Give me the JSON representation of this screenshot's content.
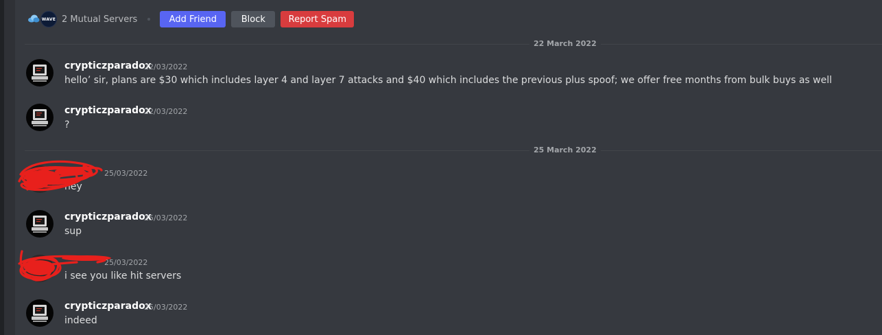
{
  "header": {
    "server_icon_label": "WAVE",
    "mutual_servers": "2 Mutual Servers",
    "add_friend_label": "Add Friend",
    "block_label": "Block",
    "report_spam_label": "Report Spam"
  },
  "dividers": [
    {
      "label": "22 March 2022"
    },
    {
      "label": "25 March 2022"
    }
  ],
  "messages": [
    {
      "author": "crypticzparadox",
      "timestamp": "22/03/2022",
      "content": "hello’  sir, plans are $30  which includes layer 4 and layer 7 attacks and $40 which includes the previous plus spoof; we offer free months from bulk buys as well"
    },
    {
      "author": "crypticzparadox",
      "timestamp": "22/03/2022",
      "content": "?"
    },
    {
      "author": "",
      "timestamp": "25/03/2022",
      "content": "hey"
    },
    {
      "author": "crypticzparadox",
      "timestamp": "25/03/2022",
      "content": "sup"
    },
    {
      "author": "",
      "timestamp": "25/03/2022",
      "content": "i see you like hit servers"
    },
    {
      "author": "crypticzparadox",
      "timestamp": "25/03/2022",
      "content": "indeed"
    }
  ],
  "colors": {
    "background": "#36393f",
    "add_friend": "#5865f2",
    "block": "#4f545c",
    "report_spam": "#d83c3e",
    "redaction": "#e8201c"
  }
}
